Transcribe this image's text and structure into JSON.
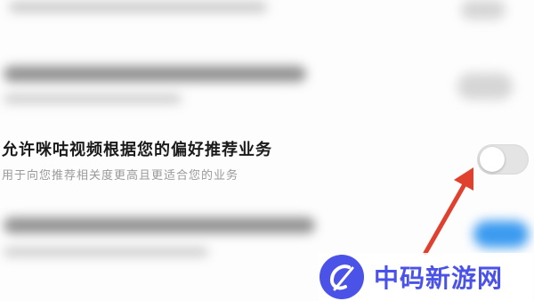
{
  "setting": {
    "title": "允许咪咕视频根据您的偏好推荐业务",
    "description": "用于向您推荐相关度更高且更适合您的业务",
    "toggle_state": "off"
  },
  "watermark": {
    "text": "中码新游网",
    "logo": "c-swoosh-logo"
  },
  "colors": {
    "watermark": "#4a52e8",
    "arrow": "#e0412f",
    "toggle_off": "#e4e4e4",
    "toggle_on_blurred": "#3c9bf0"
  },
  "icons": {
    "arrow": "red-pointer-arrow-icon"
  }
}
